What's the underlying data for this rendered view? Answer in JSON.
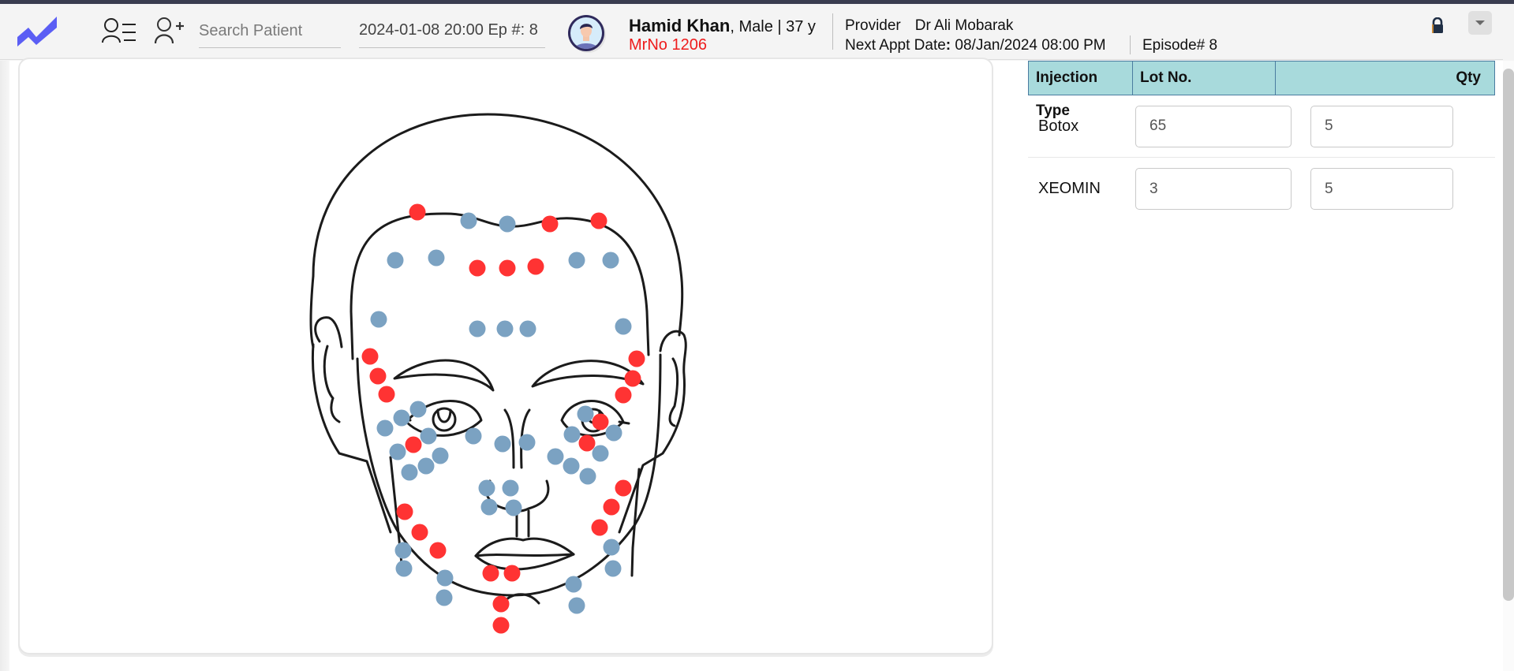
{
  "header": {
    "logo": "app-logo-zigzag",
    "icons": {
      "patient_list": "patient-list-icon",
      "add_patient": "add-patient-icon",
      "lock": "lock-icon",
      "dropdown": "caret-down-icon"
    },
    "search_placeholder": "Search Patient",
    "search_value": "",
    "visit_info": "2024-01-08 20:00 Ep #: 8",
    "patient": {
      "name": "Hamid Khan",
      "meta": ", Male | 37 y",
      "mrno": "MrNo 1206"
    },
    "provider_label": "Provider",
    "provider_name": "Dr Ali Mobarak",
    "next_appt_label": "Next Appt Date",
    "next_appt_colon": ":",
    "next_appt_value": " 08/Jan/2024 08:00 PM",
    "episode": "Episode# 8"
  },
  "colors": {
    "brand": "#5b5ef4",
    "mrno": "#ee1c1c",
    "table_header": "#a8dadc",
    "injection_red": "#ff3333",
    "injection_blue": "#7ba2c2"
  },
  "face_chart": {
    "image": "face-diagram",
    "legend_note": "red and blue dots mark injection sites",
    "red_count": 26,
    "blue_count": 45
  },
  "injection_table": {
    "columns": [
      "Injection Type",
      "Lot No.",
      "Qty"
    ],
    "rows": [
      {
        "type": "Botox",
        "lot": "65",
        "qty": "5"
      },
      {
        "type": "XEOMIN",
        "lot": "3",
        "qty": "5"
      }
    ]
  }
}
